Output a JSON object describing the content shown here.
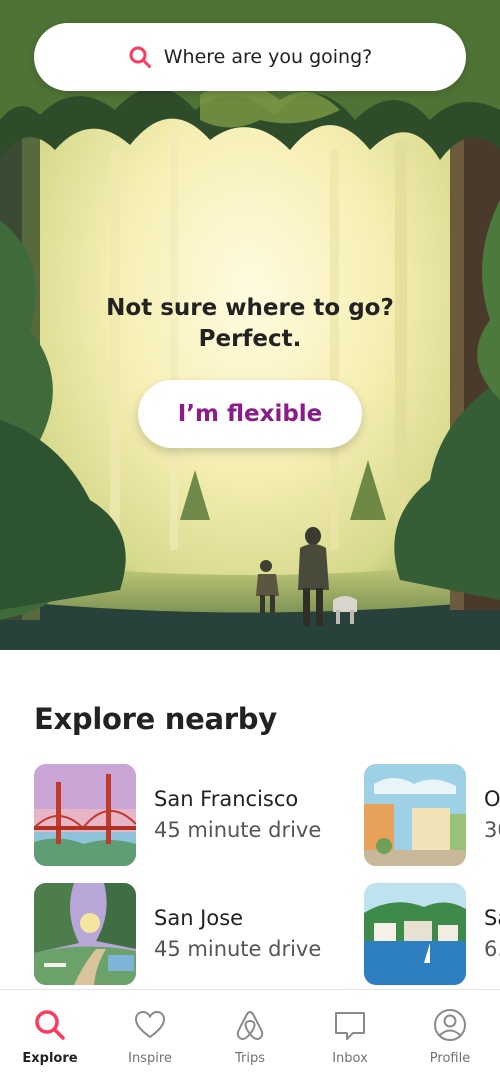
{
  "search": {
    "placeholder": "Where are you going?",
    "icon": "search-icon"
  },
  "hero": {
    "line1": "Not sure where to go?",
    "line2": "Perfect.",
    "button_label": "I’m flexible"
  },
  "explore_nearby": {
    "title": "Explore nearby",
    "items": [
      {
        "name": "San Francisco",
        "subtitle": "45 minute drive"
      },
      {
        "name": "San Jose",
        "subtitle": "45 minute drive"
      },
      {
        "name": "O",
        "subtitle": "30"
      },
      {
        "name": "Sa",
        "subtitle": "6."
      }
    ]
  },
  "nav": {
    "items": [
      {
        "label": "Explore",
        "icon": "search-icon",
        "active": true
      },
      {
        "label": "Inspire",
        "icon": "heart-icon",
        "active": false
      },
      {
        "label": "Trips",
        "icon": "airbnb-logo-icon",
        "active": false
      },
      {
        "label": "Inbox",
        "icon": "chat-bubble-icon",
        "active": false
      },
      {
        "label": "Profile",
        "icon": "user-icon",
        "active": false
      }
    ]
  },
  "colors": {
    "brand": "#ff385c",
    "flexible_text": "#8b1a8a",
    "text_primary": "#222222",
    "text_secondary": "#717171"
  }
}
